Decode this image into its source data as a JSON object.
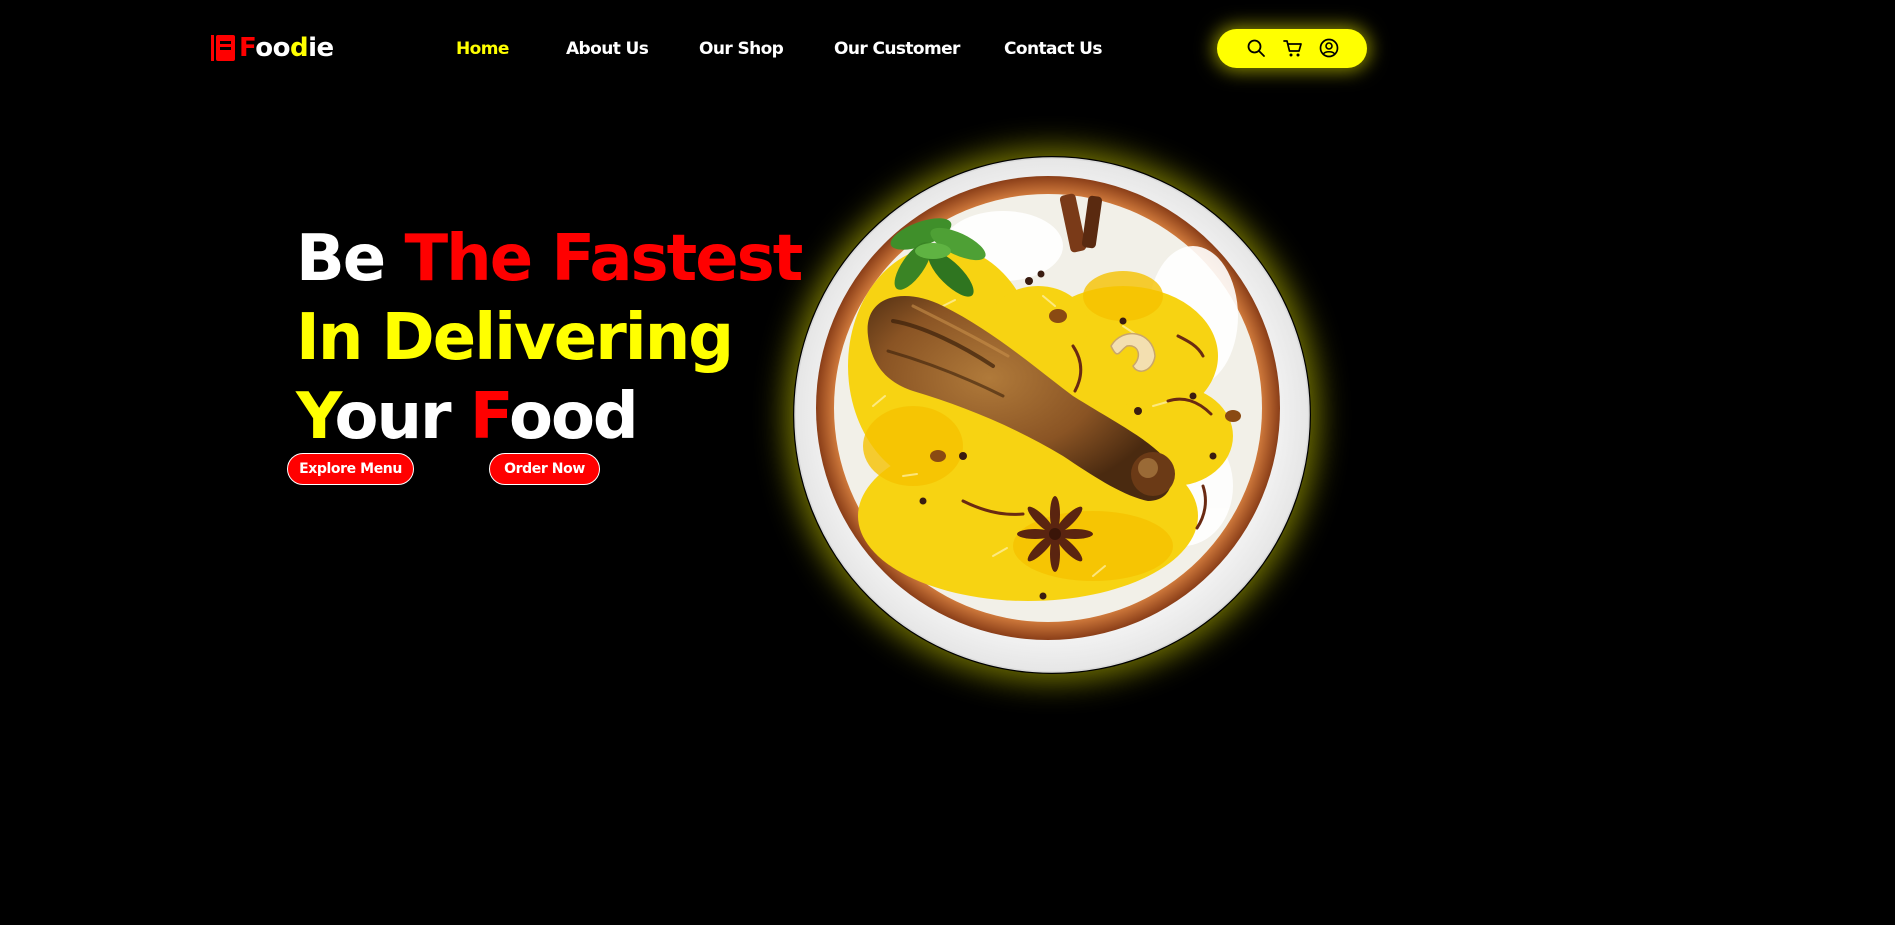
{
  "brand": {
    "name": "Foodie",
    "parts": [
      "F",
      "oo",
      "d",
      "ie"
    ]
  },
  "nav": {
    "items": [
      {
        "label": "Home",
        "active": true
      },
      {
        "label": "About Us",
        "active": false
      },
      {
        "label": "Our Shop",
        "active": false
      },
      {
        "label": "Our Customer",
        "active": false
      },
      {
        "label": "Contact Us",
        "active": false
      }
    ]
  },
  "actions": {
    "icons": [
      "search-icon",
      "cart-icon",
      "user-icon"
    ]
  },
  "hero": {
    "line1": {
      "a": "Be ",
      "b": "The Fastest"
    },
    "line2": {
      "a": "In Delivering"
    },
    "line3": {
      "a": "Y",
      "b": "our ",
      "c": "F",
      "d": "ood"
    },
    "buttons": {
      "explore": "Explore Menu",
      "order": "Order Now"
    }
  },
  "colors": {
    "background": "#000000",
    "accent_yellow": "#ffff00",
    "accent_red": "#ff0000",
    "text_white": "#ffffff"
  }
}
